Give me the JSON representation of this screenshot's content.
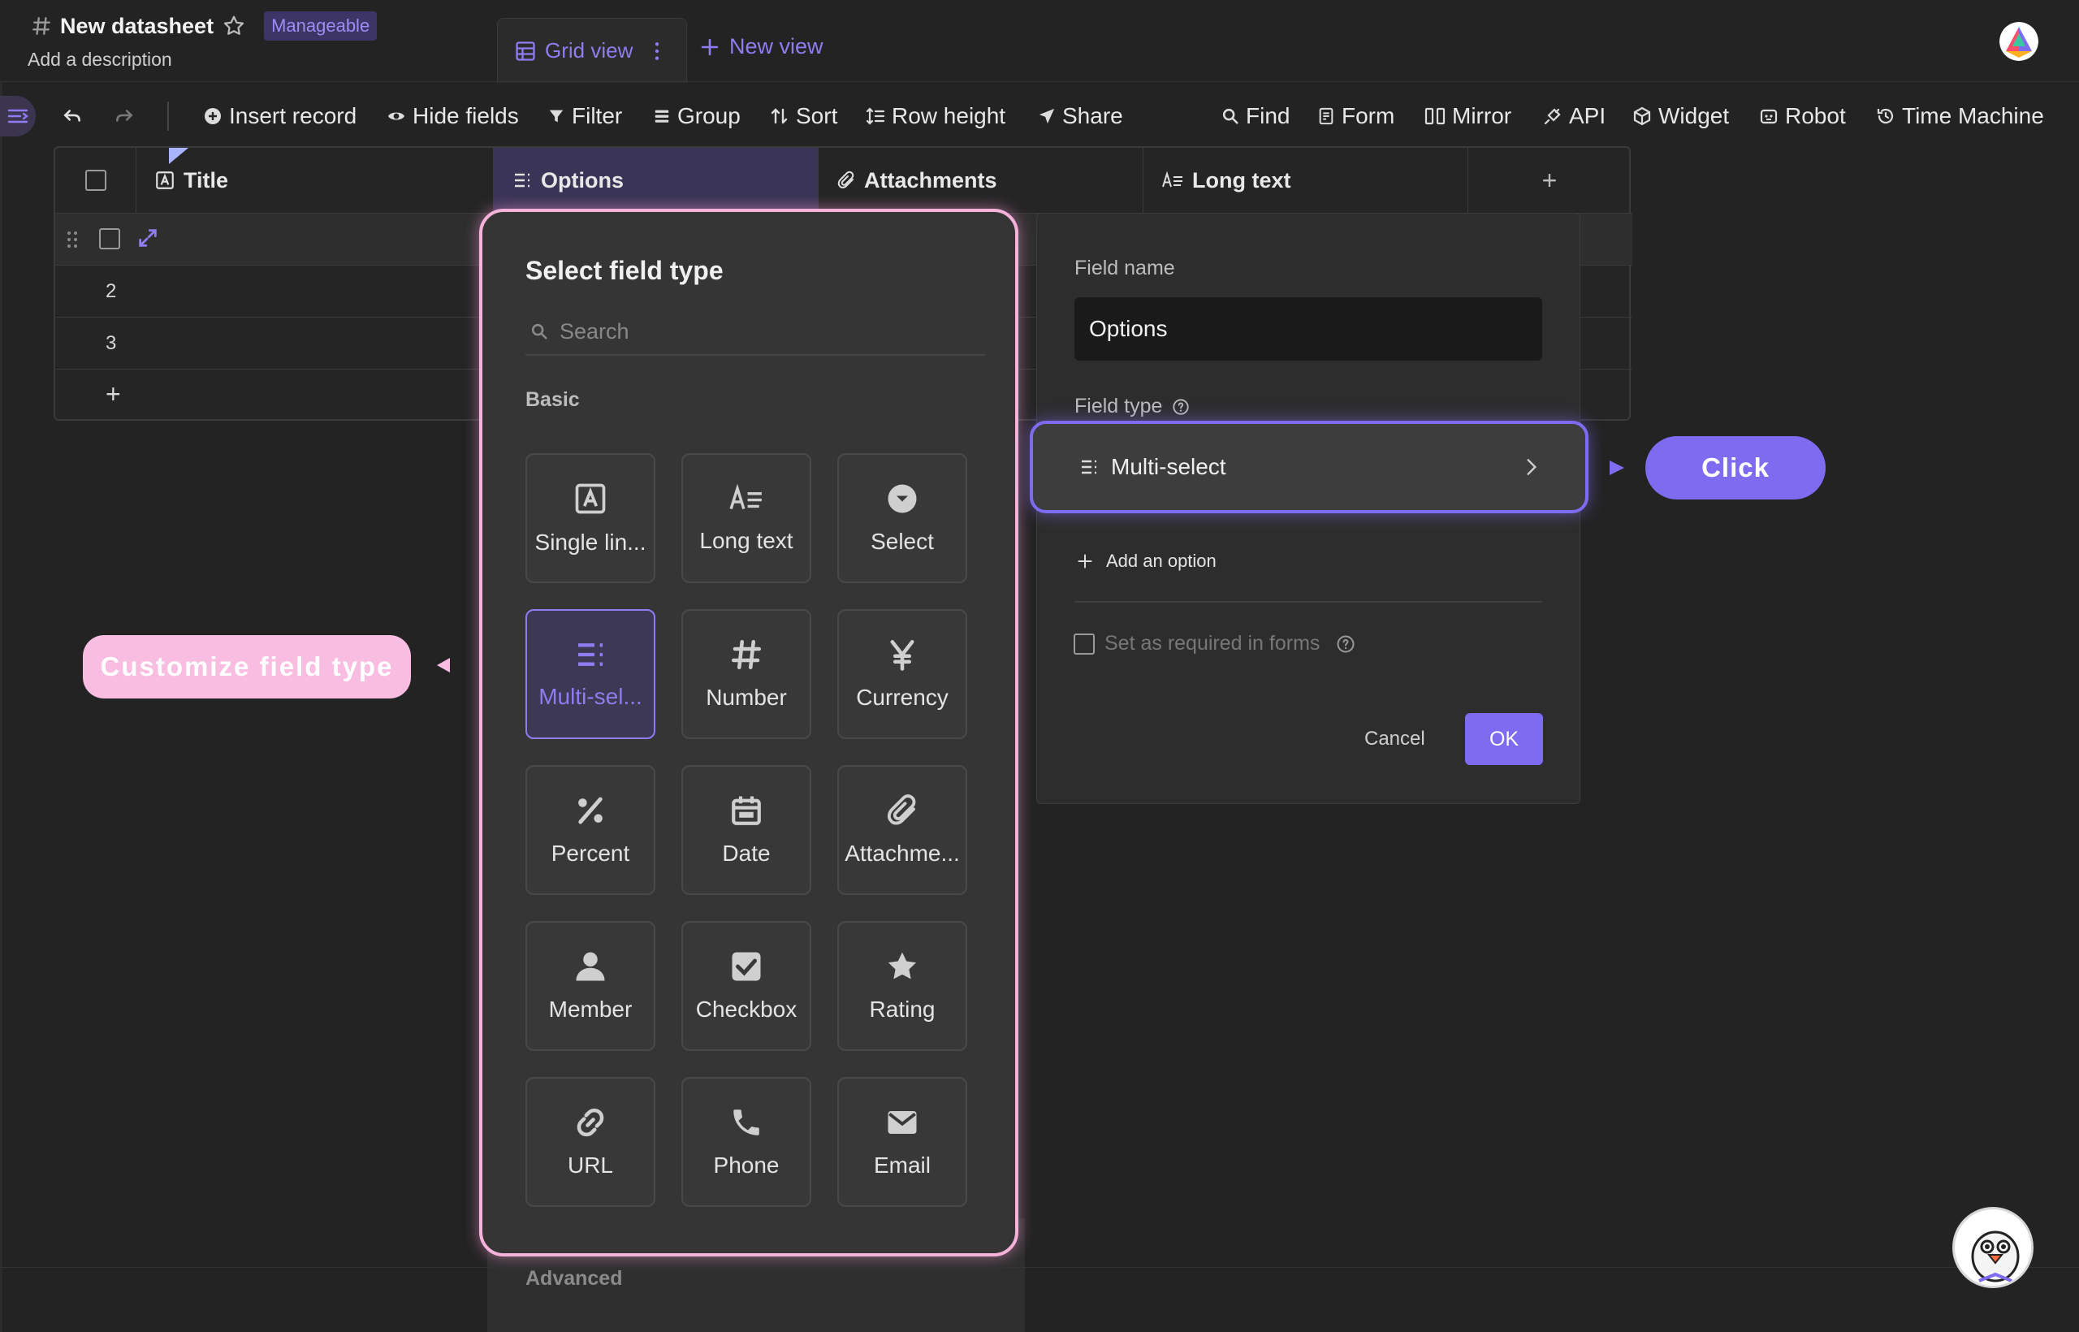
{
  "header": {
    "title": "New datasheet",
    "badge": "Manageable",
    "description": "Add a description",
    "tabs": {
      "grid_view": "Grid view",
      "new_view": "New view"
    }
  },
  "toolbar": {
    "insert_record": "Insert record",
    "hide_fields": "Hide fields",
    "filter": "Filter",
    "group": "Group",
    "sort": "Sort",
    "row_height": "Row height",
    "share": "Share",
    "find": "Find",
    "form": "Form",
    "mirror": "Mirror",
    "api": "API",
    "widget": "Widget",
    "robot": "Robot",
    "time_machine": "Time Machine"
  },
  "grid": {
    "columns": [
      "Title",
      "Options",
      "Attachments",
      "Long text"
    ],
    "add_column": "+",
    "rows": [
      "2",
      "3"
    ],
    "add_row": "+"
  },
  "field_type_picker": {
    "title": "Select field type",
    "search_placeholder": "Search",
    "basic_label": "Basic",
    "advanced_label": "Advanced",
    "types": [
      {
        "label": "Single lin...",
        "icon": "single-line-text-icon"
      },
      {
        "label": "Long text",
        "icon": "long-text-icon"
      },
      {
        "label": "Select",
        "icon": "select-icon"
      },
      {
        "label": "Multi-sel...",
        "icon": "multi-select-icon",
        "selected": true
      },
      {
        "label": "Number",
        "icon": "number-icon"
      },
      {
        "label": "Currency",
        "icon": "currency-icon"
      },
      {
        "label": "Percent",
        "icon": "percent-icon"
      },
      {
        "label": "Date",
        "icon": "date-icon"
      },
      {
        "label": "Attachme...",
        "icon": "attachment-icon"
      },
      {
        "label": "Member",
        "icon": "member-icon"
      },
      {
        "label": "Checkbox",
        "icon": "checkbox-icon"
      },
      {
        "label": "Rating",
        "icon": "rating-icon"
      },
      {
        "label": "URL",
        "icon": "url-icon"
      },
      {
        "label": "Phone",
        "icon": "phone-icon"
      },
      {
        "label": "Email",
        "icon": "email-icon"
      }
    ]
  },
  "field_editor": {
    "field_name_label": "Field name",
    "field_name_value": "Options",
    "field_type_label": "Field type",
    "field_type_value": "Multi-select",
    "add_option": "Add an option",
    "required_label": "Set as required in forms",
    "cancel": "Cancel",
    "ok": "OK"
  },
  "annotations": {
    "click": "Click",
    "customize": "Customize field type"
  },
  "colors": {
    "accent": "#7d6cf0",
    "accent_text": "#8e7cf0",
    "highlight_pink": "#f5b3dc",
    "background": "#232323"
  }
}
